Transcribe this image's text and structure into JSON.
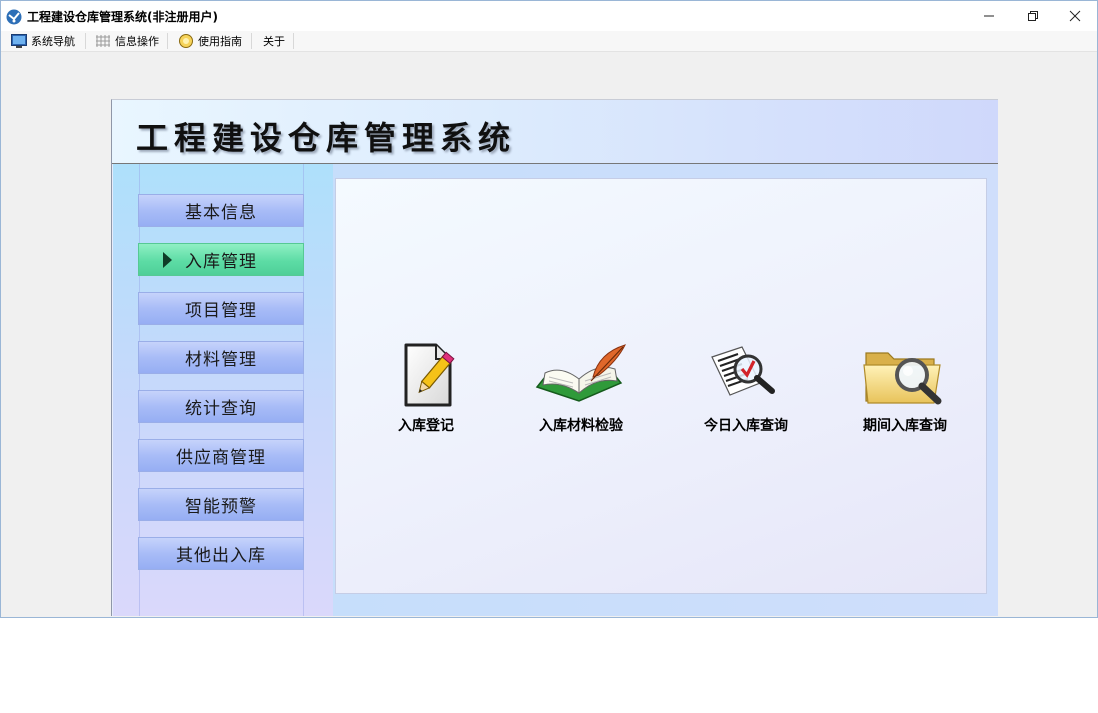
{
  "window": {
    "title": "工程建设仓库管理系统(非注册用户)"
  },
  "menu": {
    "items": [
      {
        "label": "系统导航",
        "icon": "monitor-icon"
      },
      {
        "label": "信息操作",
        "icon": "grid-icon"
      },
      {
        "label": "使用指南",
        "icon": "help-globe-icon"
      },
      {
        "label": "关于"
      }
    ]
  },
  "banner": {
    "title": "工程建设仓库管理系统"
  },
  "sidebar": {
    "items": [
      {
        "label": "基本信息",
        "active": false
      },
      {
        "label": "入库管理",
        "active": true
      },
      {
        "label": "项目管理",
        "active": false
      },
      {
        "label": "材料管理",
        "active": false
      },
      {
        "label": "统计查询",
        "active": false
      },
      {
        "label": "供应商管理",
        "active": false
      },
      {
        "label": "智能预警",
        "active": false
      },
      {
        "label": "其他出入库",
        "active": false
      }
    ]
  },
  "tiles": [
    {
      "label": "入库登记",
      "icon": "document-pencil-icon"
    },
    {
      "label": "入库材料检验",
      "icon": "book-quill-icon"
    },
    {
      "label": "今日入库查询",
      "icon": "list-magnifier-icon"
    },
    {
      "label": "期间入库查询",
      "icon": "folder-magnifier-icon"
    }
  ],
  "colors": {
    "active_nav": "#5ddca5",
    "nav": "#a8bcf7",
    "banner": "#dcebfd"
  }
}
